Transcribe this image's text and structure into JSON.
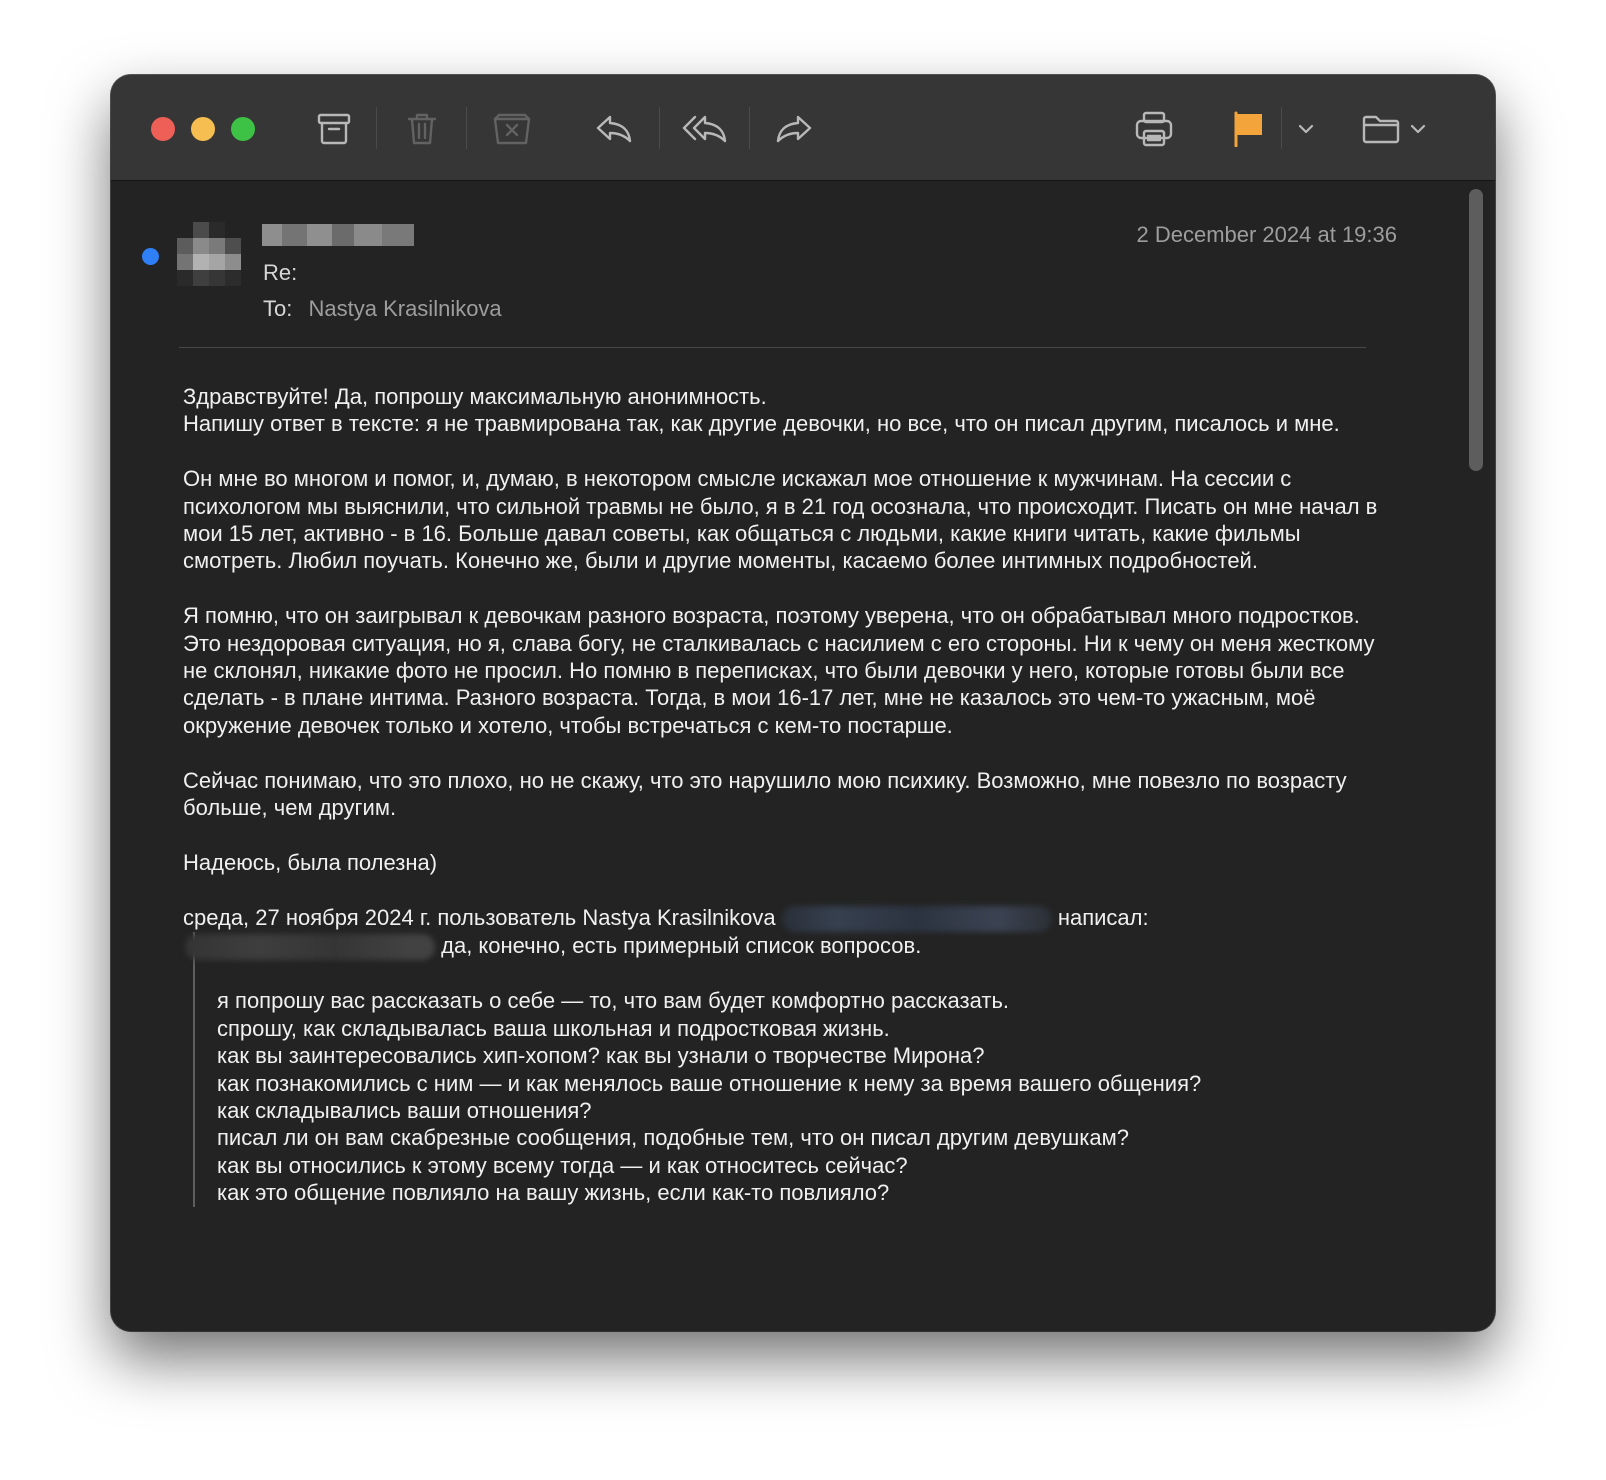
{
  "toolbar": {
    "buttons": [
      {
        "name": "archive-button",
        "icon": "archive-icon"
      },
      {
        "name": "delete-button",
        "icon": "trash-icon",
        "enabled": false
      },
      {
        "name": "junk-button",
        "icon": "junk-icon",
        "enabled": false
      },
      {
        "name": "reply-button",
        "icon": "reply-icon"
      },
      {
        "name": "reply-all-button",
        "icon": "reply-all-icon"
      },
      {
        "name": "forward-button",
        "icon": "forward-icon"
      },
      {
        "name": "print-button",
        "icon": "printer-icon"
      },
      {
        "name": "flag-button",
        "icon": "flag-icon",
        "color": "#f3a43b"
      },
      {
        "name": "move-button",
        "icon": "folder-icon"
      }
    ]
  },
  "message": {
    "date": "2 December 2024 at 19:36",
    "subject_label": "Re:",
    "to_label": "To:",
    "to_name": "Nastya Krasilnikova",
    "unread_dot_color": "#2f7ff6",
    "body": {
      "p1_line1": "Здравствуйте! Да, попрошу максимальную анонимность.",
      "p1_line2": "Напишу ответ в тексте: я не травмирована так, как другие девочки, но все, что он писал другим, писалось и мне.",
      "p2": "Он мне во многом и помог, и, думаю, в некотором смысле искажал мое отношение к мужчинам. На сессии с психологом мы выяснили, что сильной травмы не было, я в 21 год осознала, что происходит. Писать он мне начал в мои 15 лет, активно - в 16. Больше давал советы, как общаться с людьми, какие книги читать, какие фильмы смотреть. Любил поучать. Конечно же, были и другие моменты, касаемо более интимных подробностей.",
      "p3": "Я помню, что он заигрывал к девочкам разного возраста, поэтому уверена, что он обрабатывал много подростков. Это нездоровая ситуация, но я, слава богу, не сталкивалась с насилием с его стороны. Ни к чему он меня жесткому не склонял, никакие фото не просил. Но помню в переписках, что были девочки у него, которые готовы были все сделать - в плане интима. Разного возраста. Тогда, в мои 16-17 лет, мне не казалось это чем-то ужасным, моё окружение девочек только и хотело, чтобы встречаться с кем-то постарше.",
      "p4": "Сейчас понимаю, что это плохо, но не скажу, что это нарушило мою психику. Возможно, мне повезло по возрасту больше, чем другим.",
      "p5": "Надеюсь, была полезна)"
    },
    "quote_header_prefix": "среда, 27 ноября 2024 г. пользователь Nastya Krasilnikova",
    "quote_header_suffix": "написал:",
    "quote": {
      "first_line": "да, конечно, есть примерный список вопросов.",
      "questions": [
        "я попрошу вас рассказать о себе — то, что вам будет комфортно рассказать.",
        "спрошу, как складывалась ваша школьная и подростковая жизнь.",
        "как вы заинтересовались хип-хопом? как вы узнали о творчестве Мирона?",
        "как познакомились с ним — и как менялось ваше отношение к нему за время вашего общения?",
        "как складывались ваши отношения?",
        "писал ли он вам скабрезные сообщения, подобные тем, что он писал другим девушкам?",
        "как вы относились к этому всему тогда — и как относитесь сейчас?",
        "как это общение повлияло на вашу жизнь, если как-то повлияло?"
      ]
    }
  }
}
